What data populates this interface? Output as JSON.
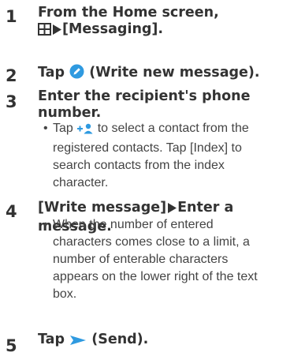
{
  "steps": [
    {
      "number": "1",
      "line1": "From the Home screen,",
      "line2_bracket": "[Messaging].",
      "icons": [
        "apps-grid-icon",
        "arrow-right-triangle-icon"
      ]
    },
    {
      "number": "2",
      "before": "Tap",
      "after": "(Write new message).",
      "icons": [
        "pencil-circle-icon"
      ]
    },
    {
      "number": "3",
      "title": "Enter the recipient's phone number.",
      "title_l1": "Enter the recipient's phone",
      "title_l2": "number.",
      "bullet_before": "Tap",
      "bullet_after_l1": "to select a contact from the",
      "bullet_l2": "registered contacts. Tap [Index] to",
      "bullet_l3": "search contacts from the index",
      "bullet_l4": "character.",
      "icons": [
        "add-contact-icon"
      ]
    },
    {
      "number": "4",
      "head_a": "[Write message]",
      "head_b": "Enter a message.",
      "bullet_l1": "When the number of entered",
      "bullet_l2": "characters comes close to a limit, a",
      "bullet_l3": "number of enterable characters",
      "bullet_l4": "appears on the lower right of the text",
      "bullet_l5": "box.",
      "icons": [
        "arrow-right-triangle-icon"
      ]
    },
    {
      "number": "5",
      "before": "Tap",
      "after": "(Send).",
      "icons": [
        "send-arrow-icon"
      ]
    }
  ],
  "bullet_char": "•",
  "colors": {
    "accent_blue": "#2f9ae0",
    "text": "#333333"
  }
}
